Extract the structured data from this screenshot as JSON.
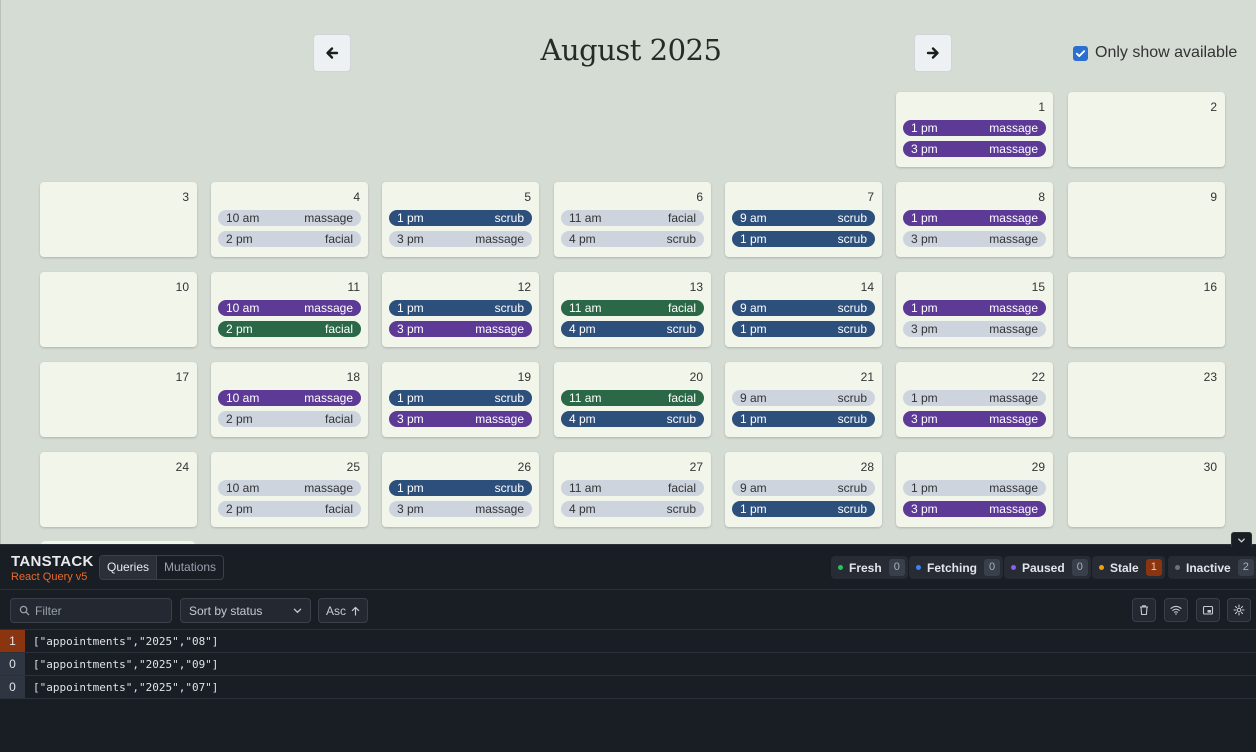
{
  "calendar": {
    "title": "August 2025",
    "prev_icon": "arrow-left-icon",
    "next_icon": "arrow-right-icon",
    "only_available": {
      "label": "Only show available",
      "checked": true
    },
    "days": [
      {
        "day": "1",
        "col": 5,
        "row": 0,
        "appts": [
          {
            "time": "1 pm",
            "treatment": "massage",
            "booked": false
          },
          {
            "time": "3 pm",
            "treatment": "massage",
            "booked": false
          }
        ]
      },
      {
        "day": "2",
        "col": 6,
        "row": 0,
        "appts": []
      },
      {
        "day": "3",
        "col": 0,
        "row": 1,
        "appts": []
      },
      {
        "day": "4",
        "col": 1,
        "row": 1,
        "appts": [
          {
            "time": "10 am",
            "treatment": "massage",
            "booked": true
          },
          {
            "time": "2 pm",
            "treatment": "facial",
            "booked": true
          }
        ]
      },
      {
        "day": "5",
        "col": 2,
        "row": 1,
        "appts": [
          {
            "time": "1 pm",
            "treatment": "scrub",
            "booked": false
          },
          {
            "time": "3 pm",
            "treatment": "massage",
            "booked": true
          }
        ]
      },
      {
        "day": "6",
        "col": 3,
        "row": 1,
        "appts": [
          {
            "time": "11 am",
            "treatment": "facial",
            "booked": true
          },
          {
            "time": "4 pm",
            "treatment": "scrub",
            "booked": true
          }
        ]
      },
      {
        "day": "7",
        "col": 4,
        "row": 1,
        "appts": [
          {
            "time": "9 am",
            "treatment": "scrub",
            "booked": false
          },
          {
            "time": "1 pm",
            "treatment": "scrub",
            "booked": false
          }
        ]
      },
      {
        "day": "8",
        "col": 5,
        "row": 1,
        "appts": [
          {
            "time": "1 pm",
            "treatment": "massage",
            "booked": false
          },
          {
            "time": "3 pm",
            "treatment": "massage",
            "booked": true
          }
        ]
      },
      {
        "day": "9",
        "col": 6,
        "row": 1,
        "appts": []
      },
      {
        "day": "10",
        "col": 0,
        "row": 2,
        "appts": []
      },
      {
        "day": "11",
        "col": 1,
        "row": 2,
        "appts": [
          {
            "time": "10 am",
            "treatment": "massage",
            "booked": false
          },
          {
            "time": "2 pm",
            "treatment": "facial",
            "booked": false
          }
        ]
      },
      {
        "day": "12",
        "col": 2,
        "row": 2,
        "appts": [
          {
            "time": "1 pm",
            "treatment": "scrub",
            "booked": false
          },
          {
            "time": "3 pm",
            "treatment": "massage",
            "booked": false
          }
        ]
      },
      {
        "day": "13",
        "col": 3,
        "row": 2,
        "appts": [
          {
            "time": "11 am",
            "treatment": "facial",
            "booked": false
          },
          {
            "time": "4 pm",
            "treatment": "scrub",
            "booked": false
          }
        ]
      },
      {
        "day": "14",
        "col": 4,
        "row": 2,
        "appts": [
          {
            "time": "9 am",
            "treatment": "scrub",
            "booked": false
          },
          {
            "time": "1 pm",
            "treatment": "scrub",
            "booked": false
          }
        ]
      },
      {
        "day": "15",
        "col": 5,
        "row": 2,
        "appts": [
          {
            "time": "1 pm",
            "treatment": "massage",
            "booked": false
          },
          {
            "time": "3 pm",
            "treatment": "massage",
            "booked": true
          }
        ]
      },
      {
        "day": "16",
        "col": 6,
        "row": 2,
        "appts": []
      },
      {
        "day": "17",
        "col": 0,
        "row": 3,
        "appts": []
      },
      {
        "day": "18",
        "col": 1,
        "row": 3,
        "appts": [
          {
            "time": "10 am",
            "treatment": "massage",
            "booked": false
          },
          {
            "time": "2 pm",
            "treatment": "facial",
            "booked": true
          }
        ]
      },
      {
        "day": "19",
        "col": 2,
        "row": 3,
        "appts": [
          {
            "time": "1 pm",
            "treatment": "scrub",
            "booked": false
          },
          {
            "time": "3 pm",
            "treatment": "massage",
            "booked": false
          }
        ]
      },
      {
        "day": "20",
        "col": 3,
        "row": 3,
        "appts": [
          {
            "time": "11 am",
            "treatment": "facial",
            "booked": false
          },
          {
            "time": "4 pm",
            "treatment": "scrub",
            "booked": false
          }
        ]
      },
      {
        "day": "21",
        "col": 4,
        "row": 3,
        "appts": [
          {
            "time": "9 am",
            "treatment": "scrub",
            "booked": true
          },
          {
            "time": "1 pm",
            "treatment": "scrub",
            "booked": false
          }
        ]
      },
      {
        "day": "22",
        "col": 5,
        "row": 3,
        "appts": [
          {
            "time": "1 pm",
            "treatment": "massage",
            "booked": true
          },
          {
            "time": "3 pm",
            "treatment": "massage",
            "booked": false
          }
        ]
      },
      {
        "day": "23",
        "col": 6,
        "row": 3,
        "appts": []
      },
      {
        "day": "24",
        "col": 0,
        "row": 4,
        "appts": []
      },
      {
        "day": "25",
        "col": 1,
        "row": 4,
        "appts": [
          {
            "time": "10 am",
            "treatment": "massage",
            "booked": true
          },
          {
            "time": "2 pm",
            "treatment": "facial",
            "booked": true
          }
        ]
      },
      {
        "day": "26",
        "col": 2,
        "row": 4,
        "appts": [
          {
            "time": "1 pm",
            "treatment": "scrub",
            "booked": false
          },
          {
            "time": "3 pm",
            "treatment": "massage",
            "booked": true
          }
        ]
      },
      {
        "day": "27",
        "col": 3,
        "row": 4,
        "appts": [
          {
            "time": "11 am",
            "treatment": "facial",
            "booked": true
          },
          {
            "time": "4 pm",
            "treatment": "scrub",
            "booked": true
          }
        ]
      },
      {
        "day": "28",
        "col": 4,
        "row": 4,
        "appts": [
          {
            "time": "9 am",
            "treatment": "scrub",
            "booked": true
          },
          {
            "time": "1 pm",
            "treatment": "scrub",
            "booked": false
          }
        ]
      },
      {
        "day": "29",
        "col": 5,
        "row": 4,
        "appts": [
          {
            "time": "1 pm",
            "treatment": "massage",
            "booked": true
          },
          {
            "time": "3 pm",
            "treatment": "massage",
            "booked": false
          }
        ]
      },
      {
        "day": "30",
        "col": 6,
        "row": 4,
        "appts": []
      }
    ],
    "colors": {
      "massage": "#5c3a96",
      "scrub": "#2d4f7c",
      "facial": "#2b6847",
      "booked": "#cdd4de",
      "background": "#d5dcd4",
      "day_card": "#f1f5ea"
    }
  },
  "devtools": {
    "brand": "TANSTACK",
    "subbrand": "React Query v5",
    "tabs": [
      {
        "label": "Queries",
        "active": true
      },
      {
        "label": "Mutations",
        "active": false
      }
    ],
    "stats": [
      {
        "label": "Fresh",
        "count": "0",
        "color": "#22c55e"
      },
      {
        "label": "Fetching",
        "count": "0",
        "color": "#3b82f6"
      },
      {
        "label": "Paused",
        "count": "0",
        "color": "#8b5cf6"
      },
      {
        "label": "Stale",
        "count": "1",
        "color": "#f59e0b"
      },
      {
        "label": "Inactive",
        "count": "2",
        "color": "#6b7280"
      }
    ],
    "filter_placeholder": "Filter",
    "sort_label": "Sort by status",
    "order_label": "Asc",
    "tools": [
      "trash-icon",
      "wifi-icon",
      "open-panel-icon",
      "settings-icon"
    ],
    "queries": [
      {
        "count": "1",
        "key": "[\"appointments\",\"2025\",\"08\"]",
        "stale": true
      },
      {
        "count": "0",
        "key": "[\"appointments\",\"2025\",\"09\"]",
        "stale": false
      },
      {
        "count": "0",
        "key": "[\"appointments\",\"2025\",\"07\"]",
        "stale": false
      }
    ]
  }
}
